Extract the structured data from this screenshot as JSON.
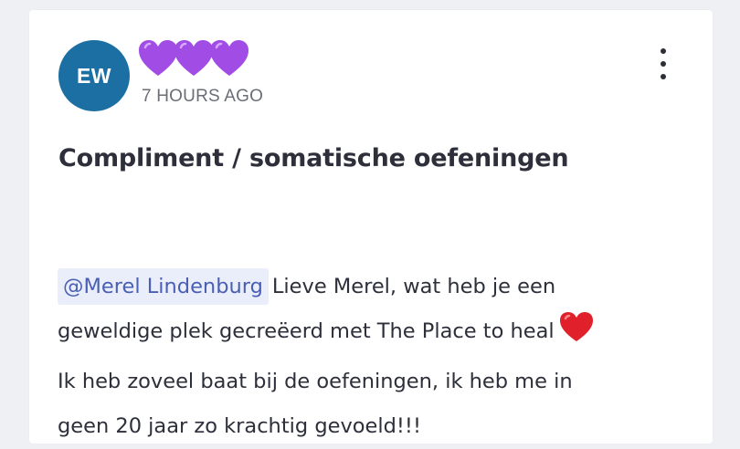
{
  "post": {
    "avatar_initials": "EW",
    "author_decoration": [
      "purple-heart",
      "purple-heart",
      "purple-heart"
    ],
    "timestamp": "7 HOURS AGO",
    "title": "Compliment / somatische oefeningen",
    "mention": "@Merel Lindenburg",
    "line1_rest": "Lieve Merel, wat heb je een",
    "line2": "geweldige plek gecreëerd met The Place to heal",
    "line3": "Ik heb zoveel baat bij de oefeningen, ik heb me in",
    "line4": "geen 20 jaar zo krachtig gevoeld!!!",
    "inline_emoji": "red-heart"
  },
  "colors": {
    "avatar_bg": "#1b6fa3",
    "mention_text": "#4a5fb3",
    "mention_bg": "#eaeefa",
    "purple_heart": "#a24ce6",
    "red_heart": "#e0202a"
  }
}
